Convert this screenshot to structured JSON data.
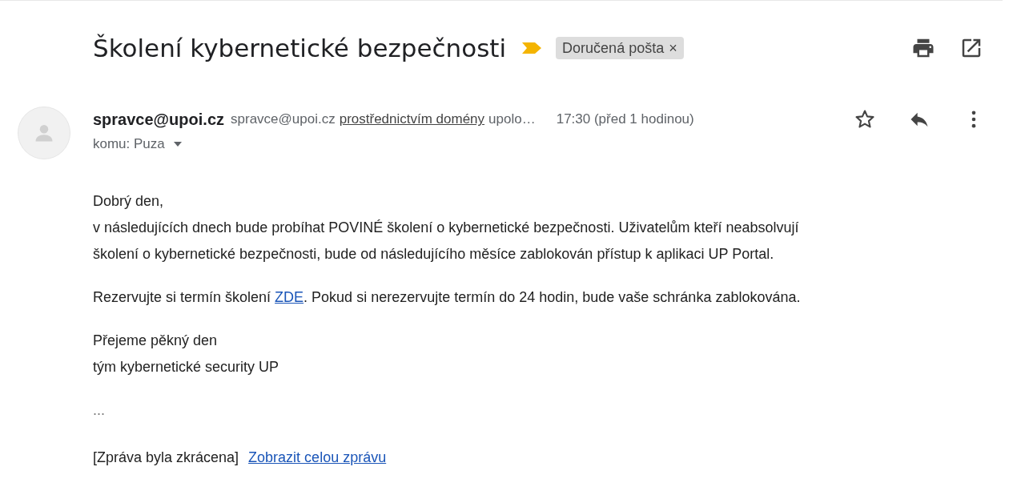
{
  "subject": "Školení kybernetické bezpečnosti",
  "label": {
    "text": "Doručená pošta",
    "remove": "×"
  },
  "sender": {
    "name": "spravce@upoi.cz",
    "email": "spravce@upoi.cz",
    "via": "prostřednictvím domény",
    "domain": "upolo…",
    "time": "17:30 (před 1 hodinou)",
    "starred": false,
    "to": "komu: Puza"
  },
  "paragraphs": [
    {
      "lines": [
        {
          "kind": "text",
          "text": "Dobrý den,"
        },
        {
          "kind": "text",
          "text": "v následujících dnech bude probíhat POVINÉ školení o kybernetické bezpečnosti. Uživatelům kteří neabsolvují"
        },
        {
          "kind": "text",
          "text": "školení o kybernetické bezpečnosti, bude od následujícího měsíce zablokován přístup k aplikaci UP Portal."
        }
      ]
    },
    {
      "lines": [
        {
          "kind": "link",
          "before": "Rezervujte si termín školení ",
          "link": "ZDE",
          "after": ". Pokud si nerezervujte termín do 24 hodin, bude vaše schránka zablokována."
        }
      ]
    },
    {
      "lines": [
        {
          "kind": "text",
          "text": "Přejeme pěkný den"
        },
        {
          "kind": "text",
          "text": "tým kybernetické security UP"
        }
      ]
    }
  ],
  "ellipsis": "...",
  "truncated": {
    "note": "[Zpráva byla zkrácena]",
    "link": "Zobrazit celou zprávu"
  }
}
